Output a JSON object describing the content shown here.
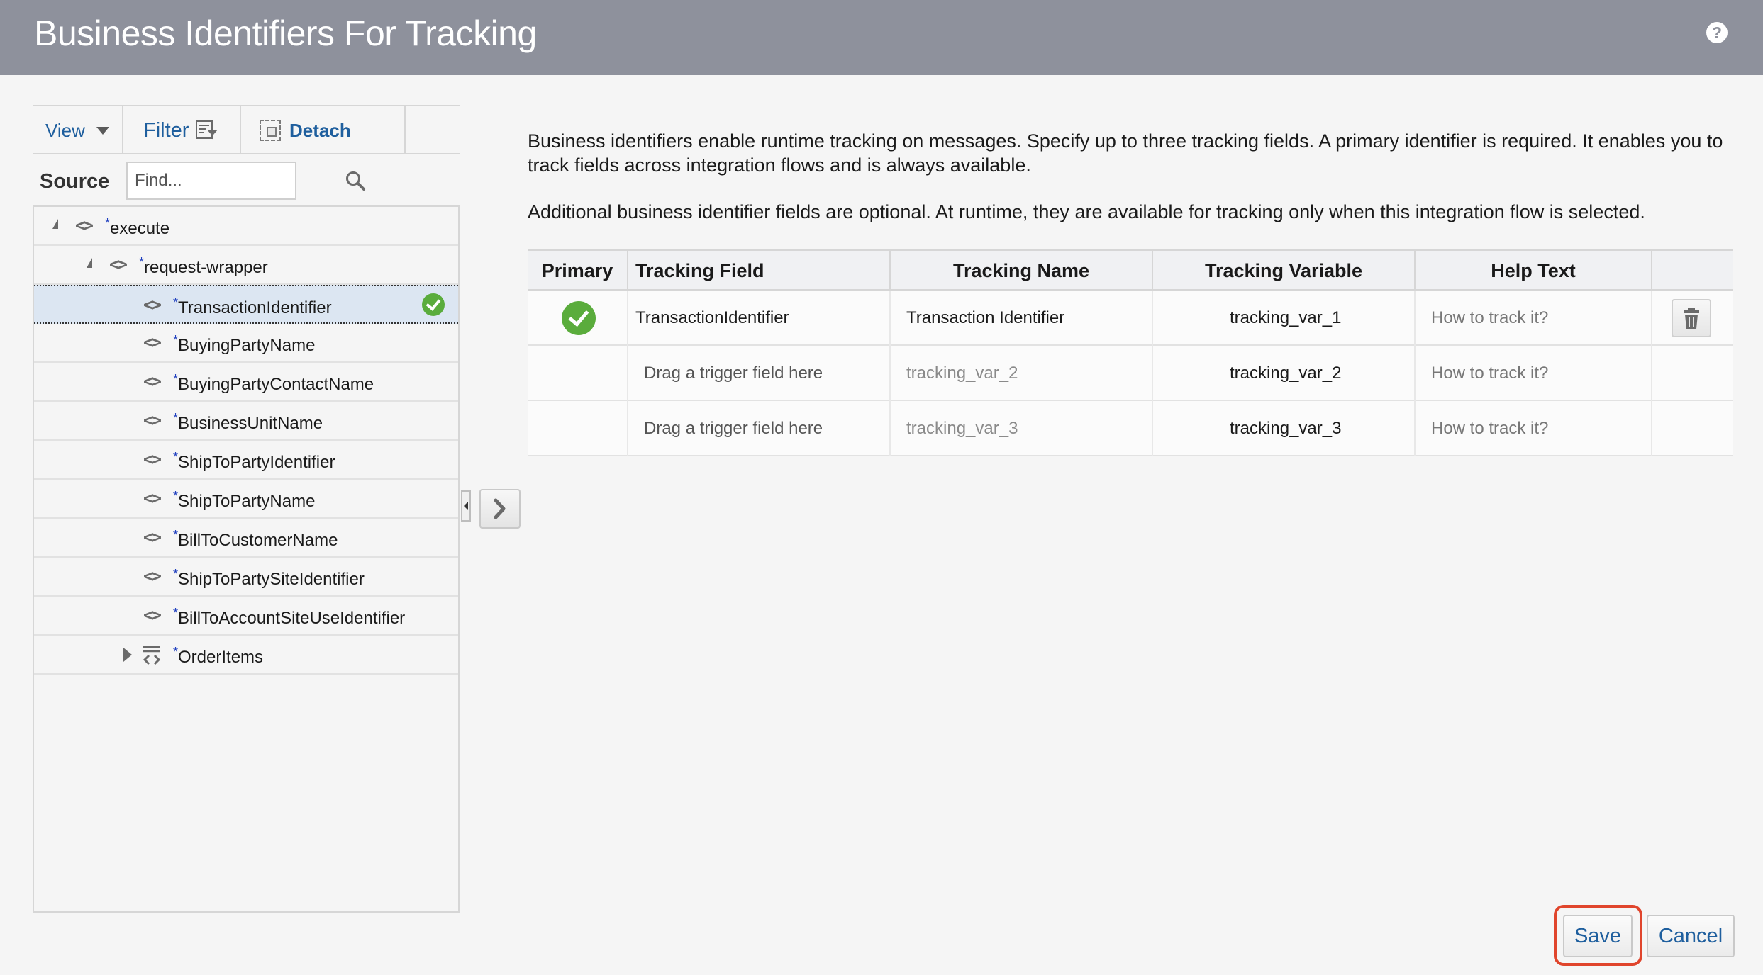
{
  "header": {
    "title": "Business Identifiers For Tracking",
    "help_icon": "help-icon"
  },
  "left_panel": {
    "toolbar": {
      "view_label": "View",
      "filter_label": "Filter",
      "detach_label": "Detach"
    },
    "source_label": "Source",
    "find_placeholder": "Find...",
    "tree": [
      {
        "label": "execute",
        "required": "*",
        "expanded": true
      },
      {
        "label": "request-wrapper",
        "required": "*",
        "expanded": true
      },
      {
        "label": "TransactionIdentifier",
        "required": "*",
        "selected": true,
        "used": true
      },
      {
        "label": "BuyingPartyName",
        "required": "*"
      },
      {
        "label": "BuyingPartyContactName",
        "required": "*"
      },
      {
        "label": "BusinessUnitName",
        "required": "*"
      },
      {
        "label": "ShipToPartyIdentifier",
        "required": "*"
      },
      {
        "label": "ShipToPartyName",
        "required": "*"
      },
      {
        "label": "BillToCustomerName",
        "required": "*"
      },
      {
        "label": "ShipToPartySiteIdentifier",
        "required": "*"
      },
      {
        "label": "BillToAccountSiteUseIdentifier",
        "required": "*"
      },
      {
        "label": "OrderItems",
        "required": "*",
        "expanded": false
      }
    ]
  },
  "main": {
    "description_1": "Business identifiers enable runtime tracking on messages. Specify up to three tracking fields. A primary identifier is required. It enables you to track fields across integration flows and is always available.",
    "description_2": "Additional business identifier fields are optional. At runtime, they are available for tracking only when this integration flow is selected.",
    "columns": [
      "Primary",
      "Tracking Field",
      "Tracking Name",
      "Tracking Variable",
      "Help Text"
    ],
    "rows": [
      {
        "primary": true,
        "tracking_field": "TransactionIdentifier",
        "tracking_name": "Transaction Identifier",
        "tracking_variable": "tracking_var_1",
        "help_text": "How to track it?"
      },
      {
        "primary": false,
        "tracking_field": "Drag a trigger field here",
        "tracking_name": "tracking_var_2",
        "tracking_variable": "tracking_var_2",
        "help_text": "How to track it?"
      },
      {
        "primary": false,
        "tracking_field": "Drag a trigger field here",
        "tracking_name": "tracking_var_3",
        "tracking_variable": "tracking_var_3",
        "help_text": "How to track it?"
      }
    ]
  },
  "footer": {
    "save_label": "Save",
    "cancel_label": "Cancel"
  },
  "colors": {
    "header_bg": "#8e919c",
    "link_blue": "#1f5f9e",
    "check_green": "#5aac3c",
    "highlight_ring": "#e0452c",
    "selected_row": "#dce6f2"
  }
}
